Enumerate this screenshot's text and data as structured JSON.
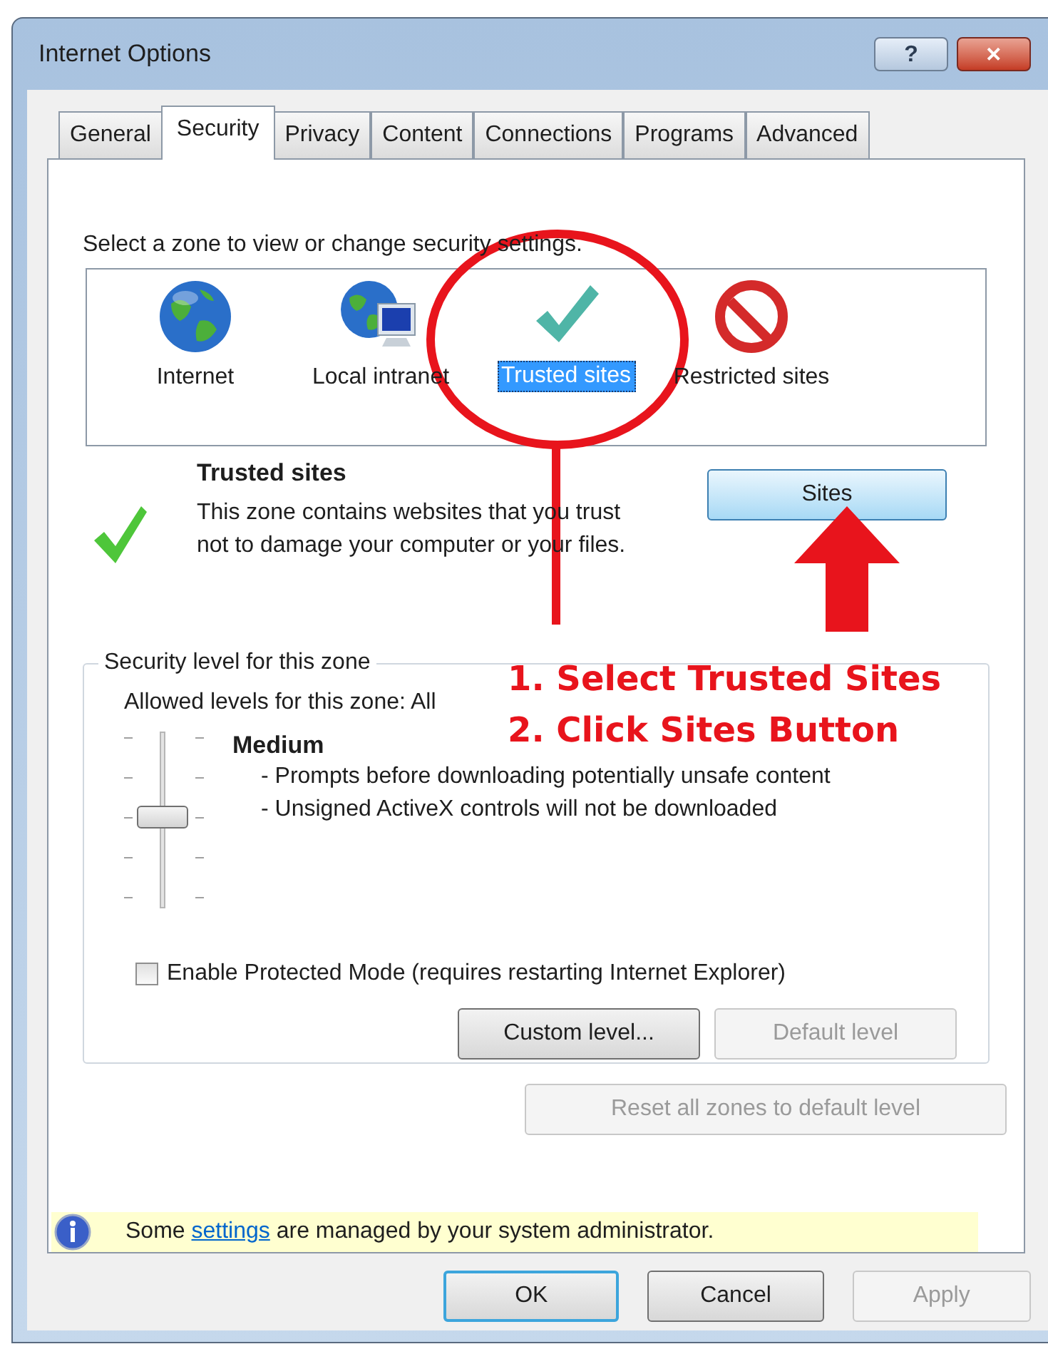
{
  "window": {
    "title": "Internet Options",
    "help_button": "?",
    "close_button": "✕"
  },
  "tabs": [
    {
      "label": "General",
      "selected": false
    },
    {
      "label": "Security",
      "selected": true
    },
    {
      "label": "Privacy",
      "selected": false
    },
    {
      "label": "Content",
      "selected": false
    },
    {
      "label": "Connections",
      "selected": false
    },
    {
      "label": "Programs",
      "selected": false
    },
    {
      "label": "Advanced",
      "selected": false
    }
  ],
  "zone_prompt": "Select a zone to view or change security settings.",
  "zones": [
    {
      "kind": "internet",
      "label": "Internet",
      "selected": false
    },
    {
      "kind": "intranet",
      "label": "Local intranet",
      "selected": false
    },
    {
      "kind": "trusted",
      "label": "Trusted sites",
      "selected": true
    },
    {
      "kind": "restricted",
      "label": "Restricted sites",
      "selected": false
    }
  ],
  "zone_info": {
    "title": "Trusted sites",
    "description": "This zone contains websites that you trust not to damage your computer or your files.",
    "sites_button": "Sites"
  },
  "security_level": {
    "legend": "Security level for this zone",
    "allowed": "Allowed levels for this zone: All",
    "level": 0.5,
    "level_name": "Medium",
    "bullets": [
      "- Prompts before downloading potentially unsafe content",
      "- Unsigned ActiveX controls will not be downloaded"
    ],
    "protected_mode": {
      "label": "Enable Protected Mode (requires restarting Internet Explorer)",
      "checked": false
    },
    "buttons": [
      {
        "label": "Custom level...",
        "disabled": false
      },
      {
        "label": "Default level",
        "disabled": true
      }
    ]
  },
  "reset_button": {
    "label": "Reset all zones to default level",
    "disabled": true
  },
  "info_bar": {
    "before": "Some ",
    "link": "settings",
    "after": " are managed by your system administrator."
  },
  "annotation": [
    "1. Select Trusted Sites",
    "2. Click Sites Button"
  ],
  "dialog_buttons": [
    {
      "label": "OK",
      "disabled": false,
      "default": true
    },
    {
      "label": "Cancel",
      "disabled": false,
      "default": false
    },
    {
      "label": "Apply",
      "disabled": true,
      "default": false
    }
  ]
}
